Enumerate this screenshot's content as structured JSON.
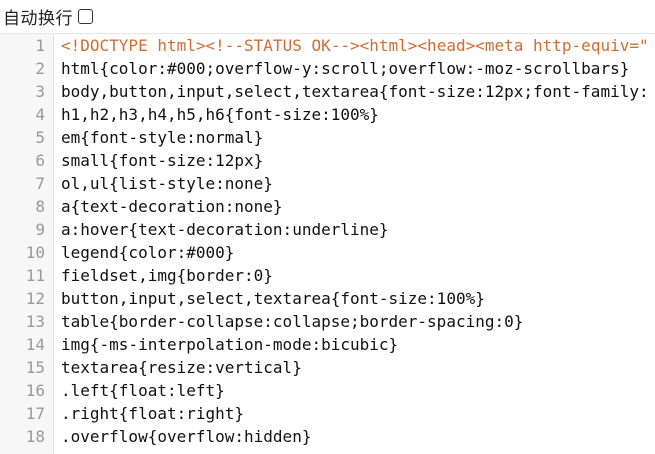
{
  "toolbar": {
    "wrap_label": "自动换行",
    "wrap_checked": false
  },
  "colors": {
    "tag": "#d16d34",
    "comment": "#8a8a8a",
    "text": "#111111",
    "gutter_bg": "#f7f7f7",
    "line_number": "#999999"
  },
  "editor": {
    "lines": [
      {
        "number": "1",
        "tokens": [
          {
            "t": "<!DOCTYPE html>",
            "k": "tag"
          },
          {
            "t": "<!--STATUS OK-->",
            "k": "tag"
          },
          {
            "t": "<html>",
            "k": "tag"
          },
          {
            "t": "<head>",
            "k": "tag"
          },
          {
            "t": "<meta http-equiv=\"",
            "k": "tag"
          }
        ]
      },
      {
        "number": "2",
        "tokens": [
          {
            "t": "html{color:#000;overflow-y:scroll;overflow:-moz-scrollbars}",
            "k": "plain"
          }
        ]
      },
      {
        "number": "3",
        "tokens": [
          {
            "t": "body,button,input,select,textarea{font-size:12px;font-family:",
            "k": "plain"
          }
        ]
      },
      {
        "number": "4",
        "tokens": [
          {
            "t": "h1,h2,h3,h4,h5,h6{font-size:100%}",
            "k": "plain"
          }
        ]
      },
      {
        "number": "5",
        "tokens": [
          {
            "t": "em{font-style:normal}",
            "k": "plain"
          }
        ]
      },
      {
        "number": "6",
        "tokens": [
          {
            "t": "small{font-size:12px}",
            "k": "plain"
          }
        ]
      },
      {
        "number": "7",
        "tokens": [
          {
            "t": "ol,ul{list-style:none}",
            "k": "plain"
          }
        ]
      },
      {
        "number": "8",
        "tokens": [
          {
            "t": "a{text-decoration:none}",
            "k": "plain"
          }
        ]
      },
      {
        "number": "9",
        "tokens": [
          {
            "t": "a:hover{text-decoration:underline}",
            "k": "plain"
          }
        ]
      },
      {
        "number": "10",
        "tokens": [
          {
            "t": "legend{color:#000}",
            "k": "plain"
          }
        ]
      },
      {
        "number": "11",
        "tokens": [
          {
            "t": "fieldset,img{border:0}",
            "k": "plain"
          }
        ]
      },
      {
        "number": "12",
        "tokens": [
          {
            "t": "button,input,select,textarea{font-size:100%}",
            "k": "plain"
          }
        ]
      },
      {
        "number": "13",
        "tokens": [
          {
            "t": "table{border-collapse:collapse;border-spacing:0}",
            "k": "plain"
          }
        ]
      },
      {
        "number": "14",
        "tokens": [
          {
            "t": "img{-ms-interpolation-mode:bicubic}",
            "k": "plain"
          }
        ]
      },
      {
        "number": "15",
        "tokens": [
          {
            "t": "textarea{resize:vertical}",
            "k": "plain"
          }
        ]
      },
      {
        "number": "16",
        "tokens": [
          {
            "t": ".left{float:left}",
            "k": "plain"
          }
        ]
      },
      {
        "number": "17",
        "tokens": [
          {
            "t": ".right{float:right}",
            "k": "plain"
          }
        ]
      },
      {
        "number": "18",
        "tokens": [
          {
            "t": ".overflow{overflow:hidden}",
            "k": "plain"
          }
        ]
      }
    ]
  }
}
